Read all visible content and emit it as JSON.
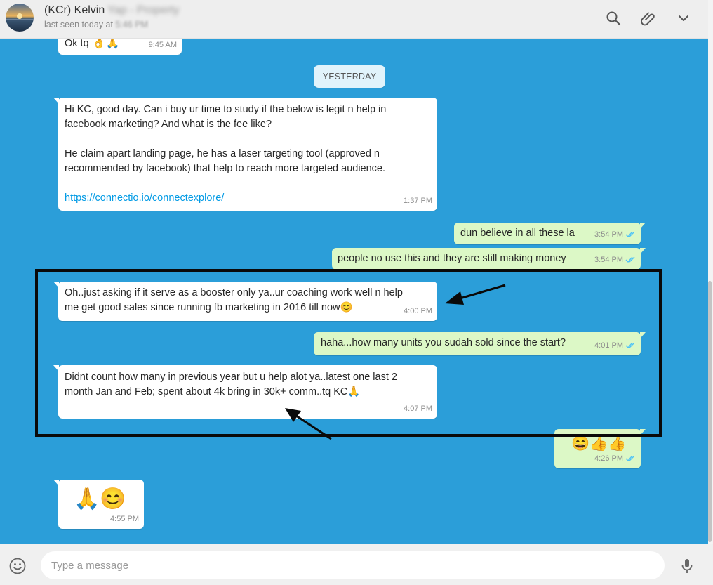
{
  "header": {
    "contact_name": "(KCr) Kelvin",
    "contact_name_obscured": "Yap - Property",
    "last_seen_prefix": "last seen today at",
    "last_seen_time": "5:46 PM"
  },
  "chat": {
    "day_separator": "YESTERDAY",
    "messages": [
      {
        "dir": "in",
        "text": "Ok tq",
        "emoji": "👌🙏",
        "time": "9:45 AM"
      },
      {
        "dir": "in",
        "lines": [
          "Hi KC, good day. Can i buy ur time to study if the below is legit n help in",
          "facebook marketing? And what is the fee like?",
          "He claim apart landing page, he has a laser targeting tool (approved n",
          "recommended by facebook) that help to reach more targeted audience."
        ],
        "link": "https://connectio.io/connectexplore/",
        "time": "1:37 PM"
      },
      {
        "dir": "out",
        "text": "dun believe in all these la",
        "time": "3:54 PM"
      },
      {
        "dir": "out",
        "text": "people no use this and they are still making money",
        "time": "3:54 PM"
      },
      {
        "dir": "in",
        "lines": [
          "Oh..just asking if it serve as a booster only ya..ur coaching work well n help",
          "me get good sales since running fb marketing in 2016 till now😊"
        ],
        "time": "4:00 PM"
      },
      {
        "dir": "out",
        "text": "haha...how many units you sudah sold since the start?",
        "time": "4:01 PM"
      },
      {
        "dir": "in",
        "lines": [
          "Didnt count how many in previous year but u help alot ya..latest one last 2",
          "month Jan and Feb; spent about 4k bring in 30k+ comm..tq KC🙏"
        ],
        "time": "4:07 PM"
      },
      {
        "dir": "out",
        "emoji": "😄👍👍",
        "time": "4:26 PM"
      },
      {
        "dir": "in",
        "emoji": "🙏😊",
        "time": "4:55 PM"
      }
    ]
  },
  "composer": {
    "placeholder": "Type a message"
  },
  "icons": {
    "header": [
      "search-icon",
      "attach-icon",
      "chevron-down-icon"
    ],
    "footer": [
      "emoji-icon",
      "microphone-icon"
    ]
  },
  "colors": {
    "chat_background": "#2b9ed9",
    "incoming_bubble": "#ffffff",
    "outgoing_bubble": "#dcf8c6",
    "read_ticks": "#4fc3f7",
    "header_background": "#eeeeee"
  }
}
